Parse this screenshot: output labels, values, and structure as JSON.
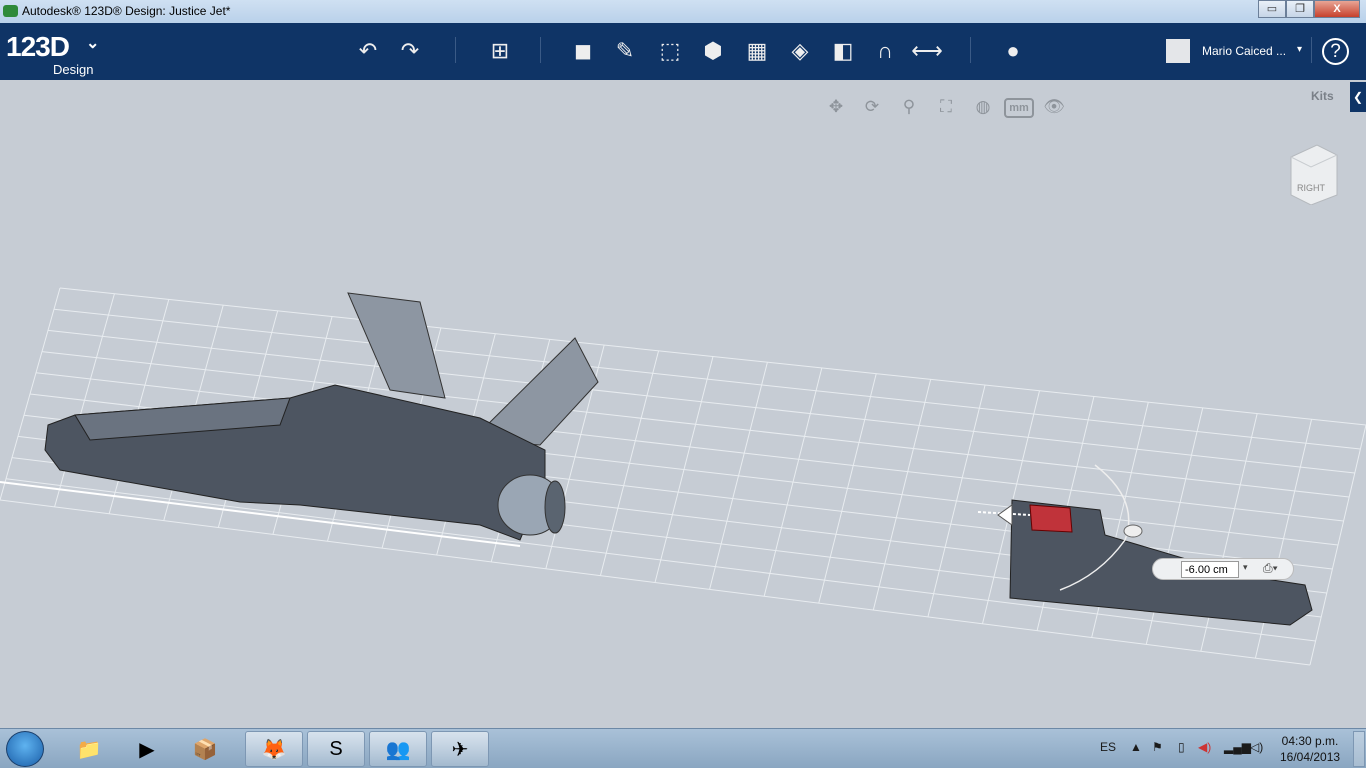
{
  "window": {
    "title": "Autodesk® 123D® Design: Justice Jet*",
    "minimize": "▭",
    "restore": "❐",
    "close": "X"
  },
  "toolbar": {
    "logo": "123D",
    "logo_sub": "Design",
    "logo_menu": "⌄",
    "user_name": "Mario Caiced ...",
    "user_dropdown": "▾",
    "help": "?",
    "tools": [
      {
        "icon": "undo-icon",
        "glyph": "↶"
      },
      {
        "icon": "redo-icon",
        "glyph": "↷"
      },
      {
        "icon": "transform-icon",
        "glyph": "⊞"
      },
      {
        "icon": "primitives-icon",
        "glyph": "◼"
      },
      {
        "icon": "sketch-icon",
        "glyph": "✎"
      },
      {
        "icon": "construct-icon",
        "glyph": "⬚"
      },
      {
        "icon": "modify-icon",
        "glyph": "⬢"
      },
      {
        "icon": "pattern-icon",
        "glyph": "▦"
      },
      {
        "icon": "grouping-icon",
        "glyph": "◈"
      },
      {
        "icon": "combine-icon",
        "glyph": "◧"
      },
      {
        "icon": "snap-icon",
        "glyph": "∩"
      },
      {
        "icon": "measure-icon",
        "glyph": "⟷"
      },
      {
        "icon": "material-icon",
        "glyph": "●"
      }
    ]
  },
  "view_tools": [
    {
      "icon": "pan-icon",
      "glyph": "✥"
    },
    {
      "icon": "orbit-icon",
      "glyph": "⟳"
    },
    {
      "icon": "zoom-icon",
      "glyph": "⚲"
    },
    {
      "icon": "fit-icon",
      "glyph": "⛶"
    },
    {
      "icon": "visual-style-icon",
      "glyph": "◍"
    }
  ],
  "units": "mm",
  "visibility_glyph": "👁",
  "kits": {
    "label": "Kits",
    "toggle": "❮"
  },
  "viewcube": {
    "face": "RIGHT"
  },
  "measurement": {
    "value": "-6.00 cm",
    "dropdown": "▾",
    "snap": "⎙▾"
  },
  "taskbar": {
    "apps": [
      {
        "name": "explorer",
        "glyph": "📁"
      },
      {
        "name": "media-player",
        "glyph": "▶"
      },
      {
        "name": "app",
        "glyph": "📦"
      },
      {
        "name": "firefox",
        "glyph": "🦊",
        "open": true
      },
      {
        "name": "skype",
        "glyph": "S",
        "open": true
      },
      {
        "name": "messenger",
        "glyph": "👥",
        "open": true
      },
      {
        "name": "123d-design",
        "glyph": "✈",
        "open": true
      }
    ],
    "language": "ES",
    "time": "04:30 p.m.",
    "date": "16/04/2013"
  },
  "colors": {
    "toolbar": "#0f3466",
    "viewport": "#c6ccd4",
    "model": "#4d5561",
    "selected": "#c0333a"
  }
}
